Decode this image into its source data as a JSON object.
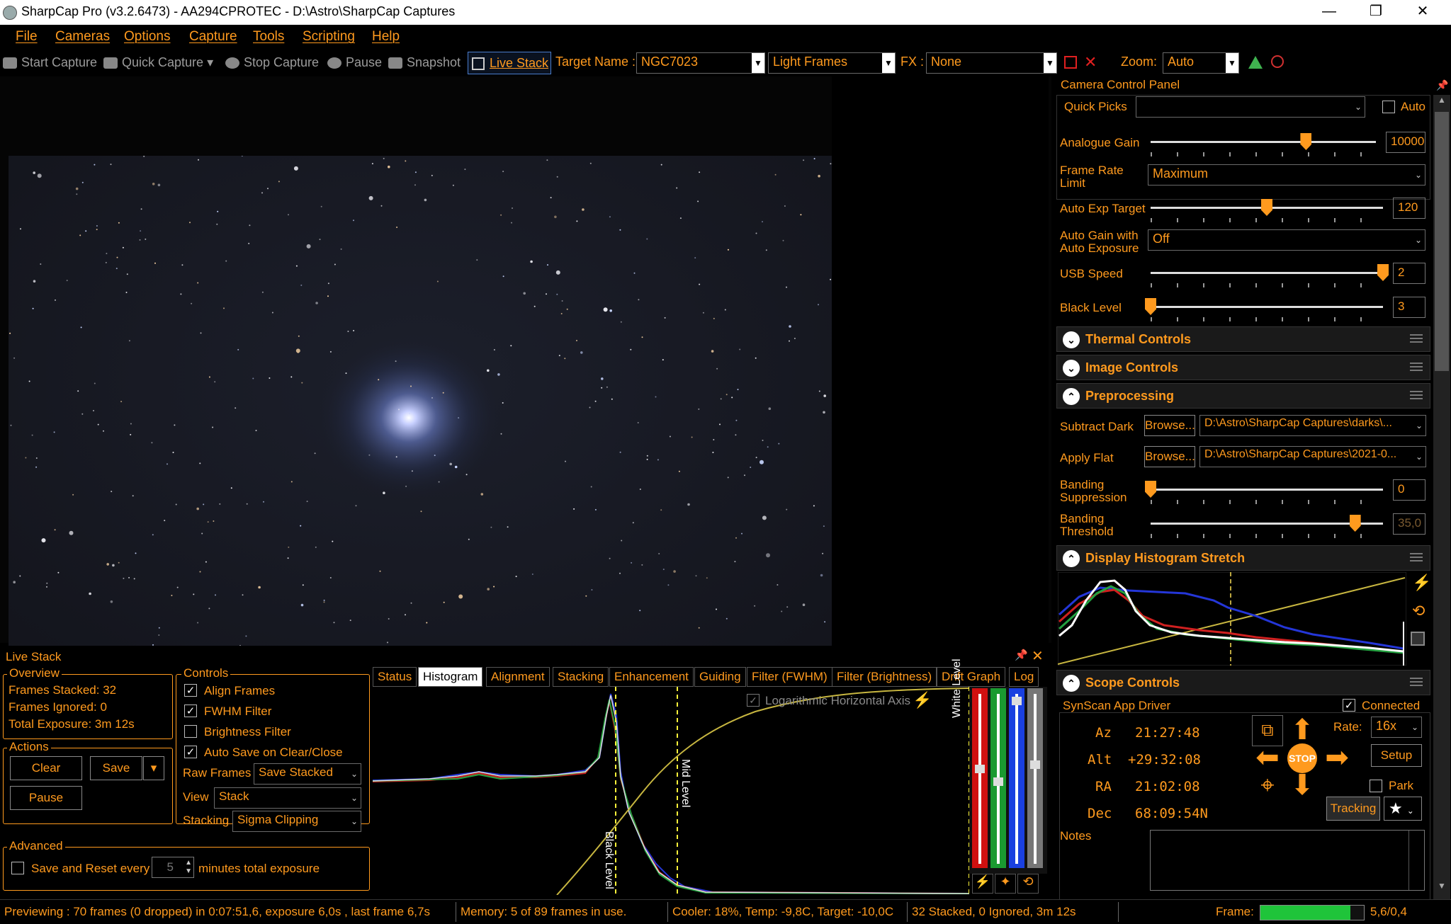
{
  "window": {
    "title": "SharpCap Pro (v3.2.6473) - AA294CPROTEC - D:\\Astro\\SharpCap Captures",
    "minimize": "—",
    "maximize": "❐",
    "close": "✕"
  },
  "menu": [
    "File",
    "Cameras",
    "Options",
    "Capture",
    "Tools",
    "Scripting",
    "Help"
  ],
  "toolbar": {
    "start_capture": "Start Capture",
    "quick_capture": "Quick Capture",
    "stop_capture": "Stop Capture",
    "pause": "Pause",
    "snapshot": "Snapshot",
    "live_stack": "Live Stack",
    "target_name_label": "Target Name :",
    "target_name_value": "NGC7023",
    "frame_type": "Light Frames",
    "fx_label": "FX :",
    "fx_value": "None",
    "zoom_label": "Zoom:",
    "zoom_value": "Auto"
  },
  "camera_panel": {
    "title": "Camera Control Panel",
    "quick_picks_label": "Quick Picks",
    "quick_picks_value": "",
    "auto_label": "Auto",
    "analogue_gain_label": "Analogue Gain",
    "analogue_gain_value": "10000",
    "frame_rate_label_1": "Frame Rate",
    "frame_rate_label_2": "Limit",
    "frame_rate_value": "Maximum",
    "auto_exp_label": "Auto Exp Target",
    "auto_exp_value": "120",
    "auto_gain_label_1": "Auto Gain with",
    "auto_gain_label_2": "Auto Exposure",
    "auto_gain_value": "Off",
    "usb_speed_label": "USB Speed",
    "usb_speed_value": "2",
    "black_level_label": "Black Level",
    "black_level_value": "3",
    "slider_fractions": {
      "analogue_gain": 0.69,
      "auto_exp": 0.5,
      "usb_speed": 1.0,
      "black_level": 0.0,
      "banding_suppression": 0.0,
      "banding_threshold": 0.88
    }
  },
  "sections": {
    "thermal": "Thermal Controls",
    "image": "Image Controls",
    "preprocessing": "Preprocessing",
    "histogram": "Display Histogram Stretch",
    "scope": "Scope Controls"
  },
  "preprocessing": {
    "subtract_dark_label": "Subtract Dark",
    "browse": "Browse...",
    "subtract_dark_path": "D:\\Astro\\SharpCap Captures\\darks\\...",
    "apply_flat_label": "Apply Flat",
    "apply_flat_path": "D:\\Astro\\SharpCap Captures\\2021-0...",
    "banding_suppression_label_1": "Banding",
    "banding_suppression_label_2": "Suppression",
    "banding_suppression_value": "0",
    "banding_threshold_label_1": "Banding",
    "banding_threshold_label_2": "Threshold",
    "banding_threshold_value": "35,0"
  },
  "scope": {
    "driver": "SynScan App Driver",
    "connected": "Connected",
    "az_label": "Az",
    "az_value": "21:27:48",
    "alt_label": "Alt",
    "alt_value": "+29:32:08",
    "ra_label": "RA",
    "ra_value": "21:02:08",
    "dec_label": "Dec",
    "dec_value": "68:09:54N",
    "rate_label": "Rate:",
    "rate_value": "16x",
    "setup": "Setup",
    "park": "Park",
    "stop": "STOP",
    "tracking": "Tracking",
    "notes_label": "Notes"
  },
  "live_stack": {
    "title": "Live Stack",
    "overview_title": "Overview",
    "frames_stacked": "Frames Stacked: 32",
    "frames_ignored": "Frames Ignored:  0",
    "total_exposure": "Total Exposure:  3m 12s",
    "actions_title": "Actions",
    "clear": "Clear",
    "save": "Save",
    "pause": "Pause",
    "controls_title": "Controls",
    "align_frames": "Align Frames",
    "fwhm_filter": "FWHM Filter",
    "brightness_filter": "Brightness Filter",
    "auto_save": "Auto Save on Clear/Close",
    "raw_frames_label": "Raw Frames",
    "raw_frames_value": "Save Stacked",
    "view_label": "View",
    "view_value": "Stack",
    "stacking_label": "Stacking",
    "stacking_value": "Sigma Clipping",
    "advanced_title": "Advanced",
    "save_reset": "Save and Reset every",
    "minutes_value": "5",
    "minutes_label": "minutes total exposure",
    "tabs": [
      "Status",
      "Histogram",
      "Alignment",
      "Stacking",
      "Enhancement",
      "Guiding",
      "Filter (FWHM)",
      "Filter (Brightness)",
      "Drift Graph",
      "Log"
    ],
    "log_axis": "Logarithmic Horizontal Axis",
    "black_level": "Black Level",
    "mid_level": "Mid Level",
    "white_level": "White Level"
  },
  "status": {
    "previewing": "Previewing : 70 frames (0 dropped) in 0:07:51,6, exposure 6,0s , last frame 6,7s",
    "memory": "Memory: 5 of 89 frames in use.",
    "cooler": "Cooler: 18%, Temp: -9,8C, Target: -10,0C",
    "stacked": "32 Stacked, 0 Ignored, 3m 12s",
    "frame_label": "Frame:",
    "frame_progress": 0.87,
    "frame_time": "5,6/0,4"
  }
}
